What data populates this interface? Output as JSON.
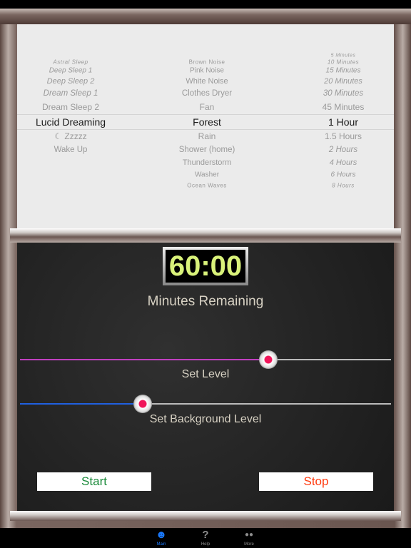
{
  "picker": {
    "columns": [
      {
        "name": "program",
        "selected_index": 5,
        "items": [
          "Astral Sleep",
          "Deep Sleep 1",
          "Deep Sleep 2",
          "Dream Sleep 1",
          "Dream Sleep 2",
          "Lucid Dreaming",
          "☾ Zzzzz",
          "Wake Up"
        ]
      },
      {
        "name": "sound",
        "selected_index": 5,
        "items": [
          "Brown Noise",
          "Pink Noise",
          "White Noise",
          "Clothes Dryer",
          "Fan",
          "Forest",
          "Rain",
          "Shower (home)",
          "Thunderstorm",
          "Washer",
          "Ocean Waves"
        ]
      },
      {
        "name": "duration",
        "selected_index": 6,
        "items": [
          "5 Minutes",
          "10 Minutes",
          "15 Minutes",
          "20 Minutes",
          "30 Minutes",
          "45 Minutes",
          "1 Hour",
          "1.5 Hours",
          "2 Hours",
          "4 Hours",
          "6 Hours",
          "8 Hours"
        ]
      }
    ]
  },
  "timer": {
    "value": "60:00",
    "caption": "Minutes Remaining"
  },
  "sliders": {
    "level": {
      "label": "Set Level",
      "value_pct": 67,
      "color": "#c040c0"
    },
    "background": {
      "label": "Set Background Level",
      "value_pct": 33,
      "color": "#2060e0"
    }
  },
  "buttons": {
    "start": "Start",
    "start_color": "#1a8a3a",
    "stop": "Stop",
    "stop_color": "#ff3b10"
  },
  "tabs": [
    {
      "label": "Main",
      "icon": "skull-headphones-icon",
      "active": true,
      "color": "#1a7aff"
    },
    {
      "label": "Help",
      "icon": "question-icon"
    },
    {
      "label": "More",
      "icon": "glasses-icon"
    }
  ]
}
